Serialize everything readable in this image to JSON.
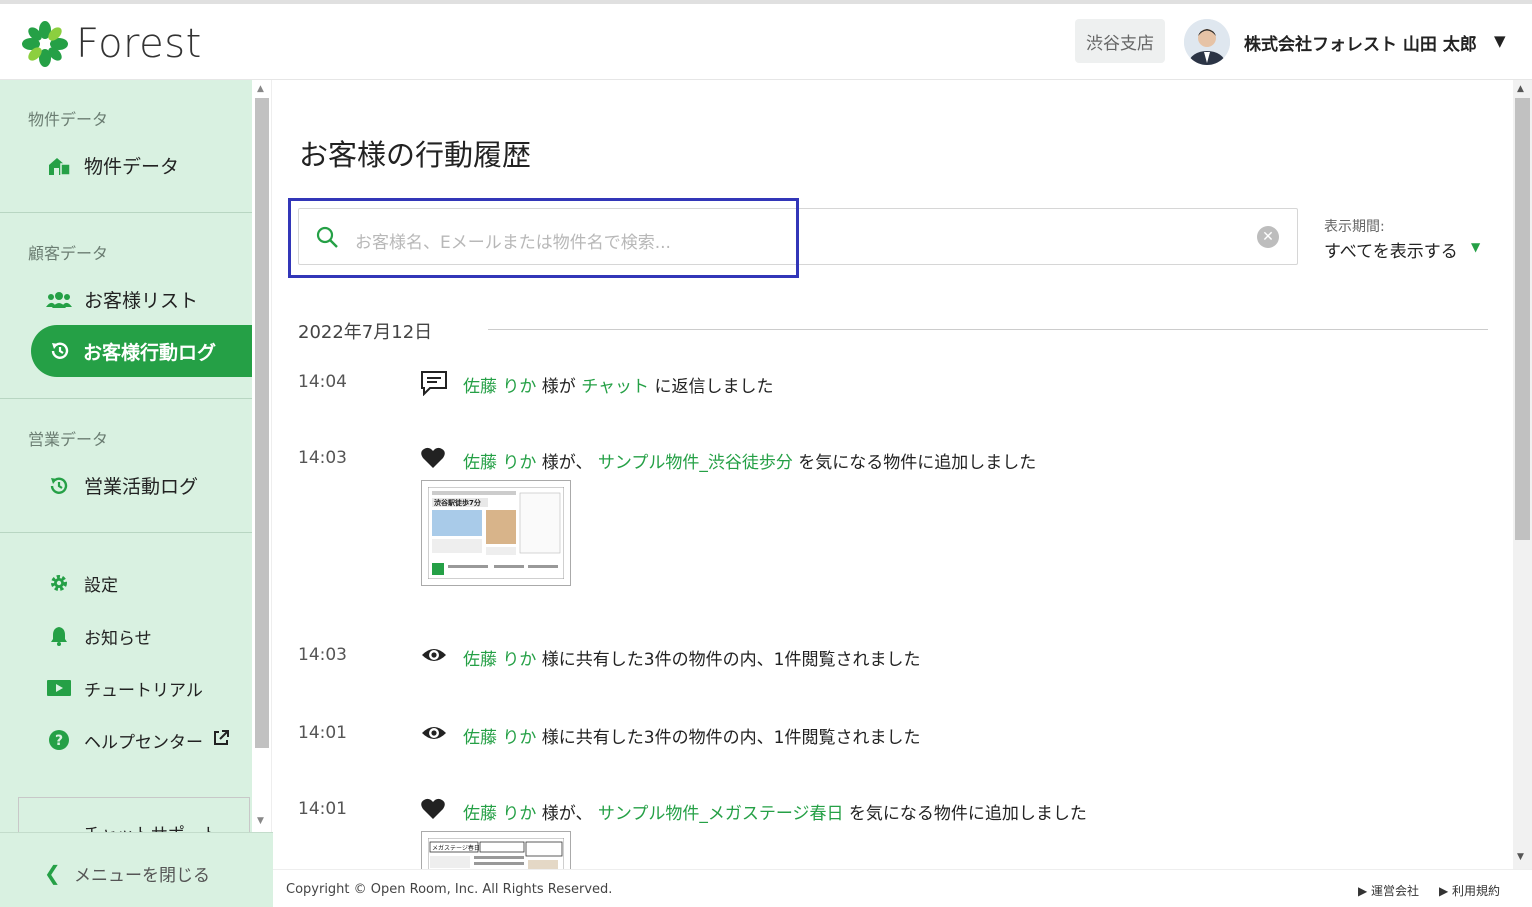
{
  "brand": {
    "name": "Forest",
    "color": "#25a046"
  },
  "header": {
    "branch": "渋谷支店",
    "user_name": "株式会社フォレスト 山田 太郎",
    "caret": "▼"
  },
  "sidebar": {
    "sections": [
      {
        "label": "物件データ",
        "items": [
          {
            "label": "物件データ",
            "icon": "house-icon"
          }
        ]
      },
      {
        "label": "顧客データ",
        "items": [
          {
            "label": "お客様リスト",
            "icon": "users-icon"
          },
          {
            "label": "お客様行動ログ",
            "icon": "history-icon",
            "active": true
          }
        ]
      },
      {
        "label": "営業データ",
        "items": [
          {
            "label": "営業活動ログ",
            "icon": "history-icon"
          }
        ]
      }
    ],
    "misc": [
      {
        "label": "設定",
        "icon": "gear-icon"
      },
      {
        "label": "お知らせ",
        "icon": "bell-icon"
      },
      {
        "label": "チュートリアル",
        "icon": "video-icon"
      },
      {
        "label": "ヘルプセンター",
        "icon": "help-icon"
      }
    ],
    "chat_support": "チャットサポート",
    "close_menu": "メニューを閉じる"
  },
  "main": {
    "title": "お客様の行動履歴",
    "search_placeholder": "お客様名、Eメールまたは物件名で検索...",
    "period_label": "表示期間:",
    "period_value": "すべてを表示する",
    "date": "2022年7月12日",
    "logs": [
      {
        "time": "14:04",
        "icon": "chat-icon",
        "customer": "佐藤 りか",
        "p1": " 様が ",
        "link": "チャット",
        "p2": " に返信しました"
      },
      {
        "time": "14:03",
        "icon": "heart-icon",
        "customer": "佐藤 りか",
        "p1": " 様が、 ",
        "link": "サンプル物件_渋谷徒歩分",
        "p2": " を気になる物件に追加しました",
        "thumb_caption": "渋谷駅徒歩7分"
      },
      {
        "time": "14:03",
        "icon": "eye-icon",
        "customer": "佐藤 りか",
        "p1": " 様に共有した3件の物件の内、1件閲覧されました",
        "link": "",
        "p2": ""
      },
      {
        "time": "14:01",
        "icon": "eye-icon",
        "customer": "佐藤 りか",
        "p1": " 様に共有した3件の物件の内、1件閲覧されました",
        "link": "",
        "p2": ""
      },
      {
        "time": "14:01",
        "icon": "heart-icon",
        "customer": "佐藤 りか",
        "p1": " 様が、 ",
        "link": "サンプル物件_メガステージ春日",
        "p2": " を気になる物件に追加しました",
        "thumb_caption": "メガステージ春日"
      }
    ]
  },
  "footer": {
    "copyright": "Copyright © Open Room, Inc. All Rights Reserved.",
    "links": [
      "▶ 運営会社",
      "▶ 利用規約"
    ]
  }
}
